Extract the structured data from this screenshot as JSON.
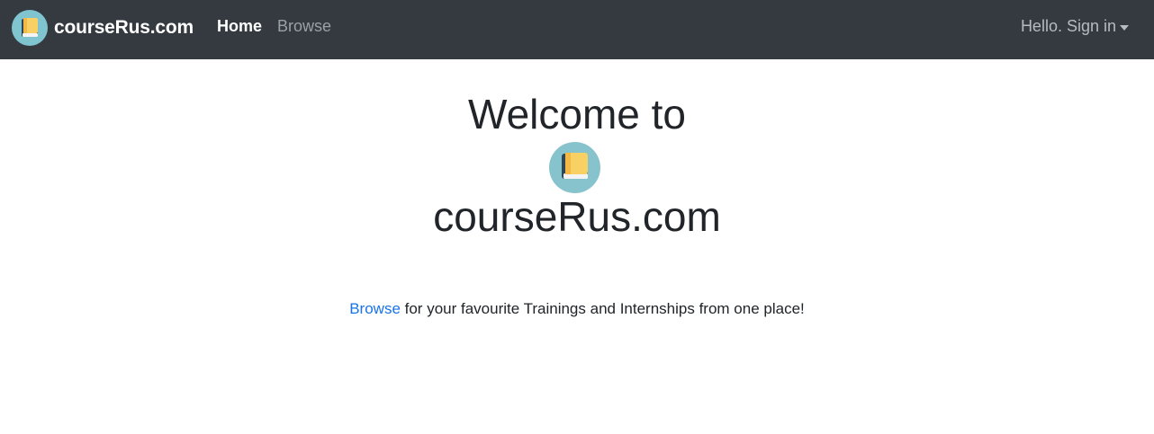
{
  "navbar": {
    "brand_title": "courseRus.com",
    "brand_icon": "book-icon",
    "links": [
      {
        "label": "Home",
        "active": true
      },
      {
        "label": "Browse",
        "active": false
      }
    ],
    "account_label": "Hello. Sign in"
  },
  "hero": {
    "line1": "Welcome to",
    "logo_icon": "book-icon",
    "line2": "courseRus.com"
  },
  "tagline": {
    "link_text": "Browse",
    "text": " for your favourite Trainings and Internships from one place!"
  },
  "colors": {
    "navbar_bg": "#343a40",
    "link_blue": "#1a73e8",
    "logo_circle": "#86c3cd",
    "book_cover": "#f9d063",
    "book_spine": "#2f4858"
  }
}
